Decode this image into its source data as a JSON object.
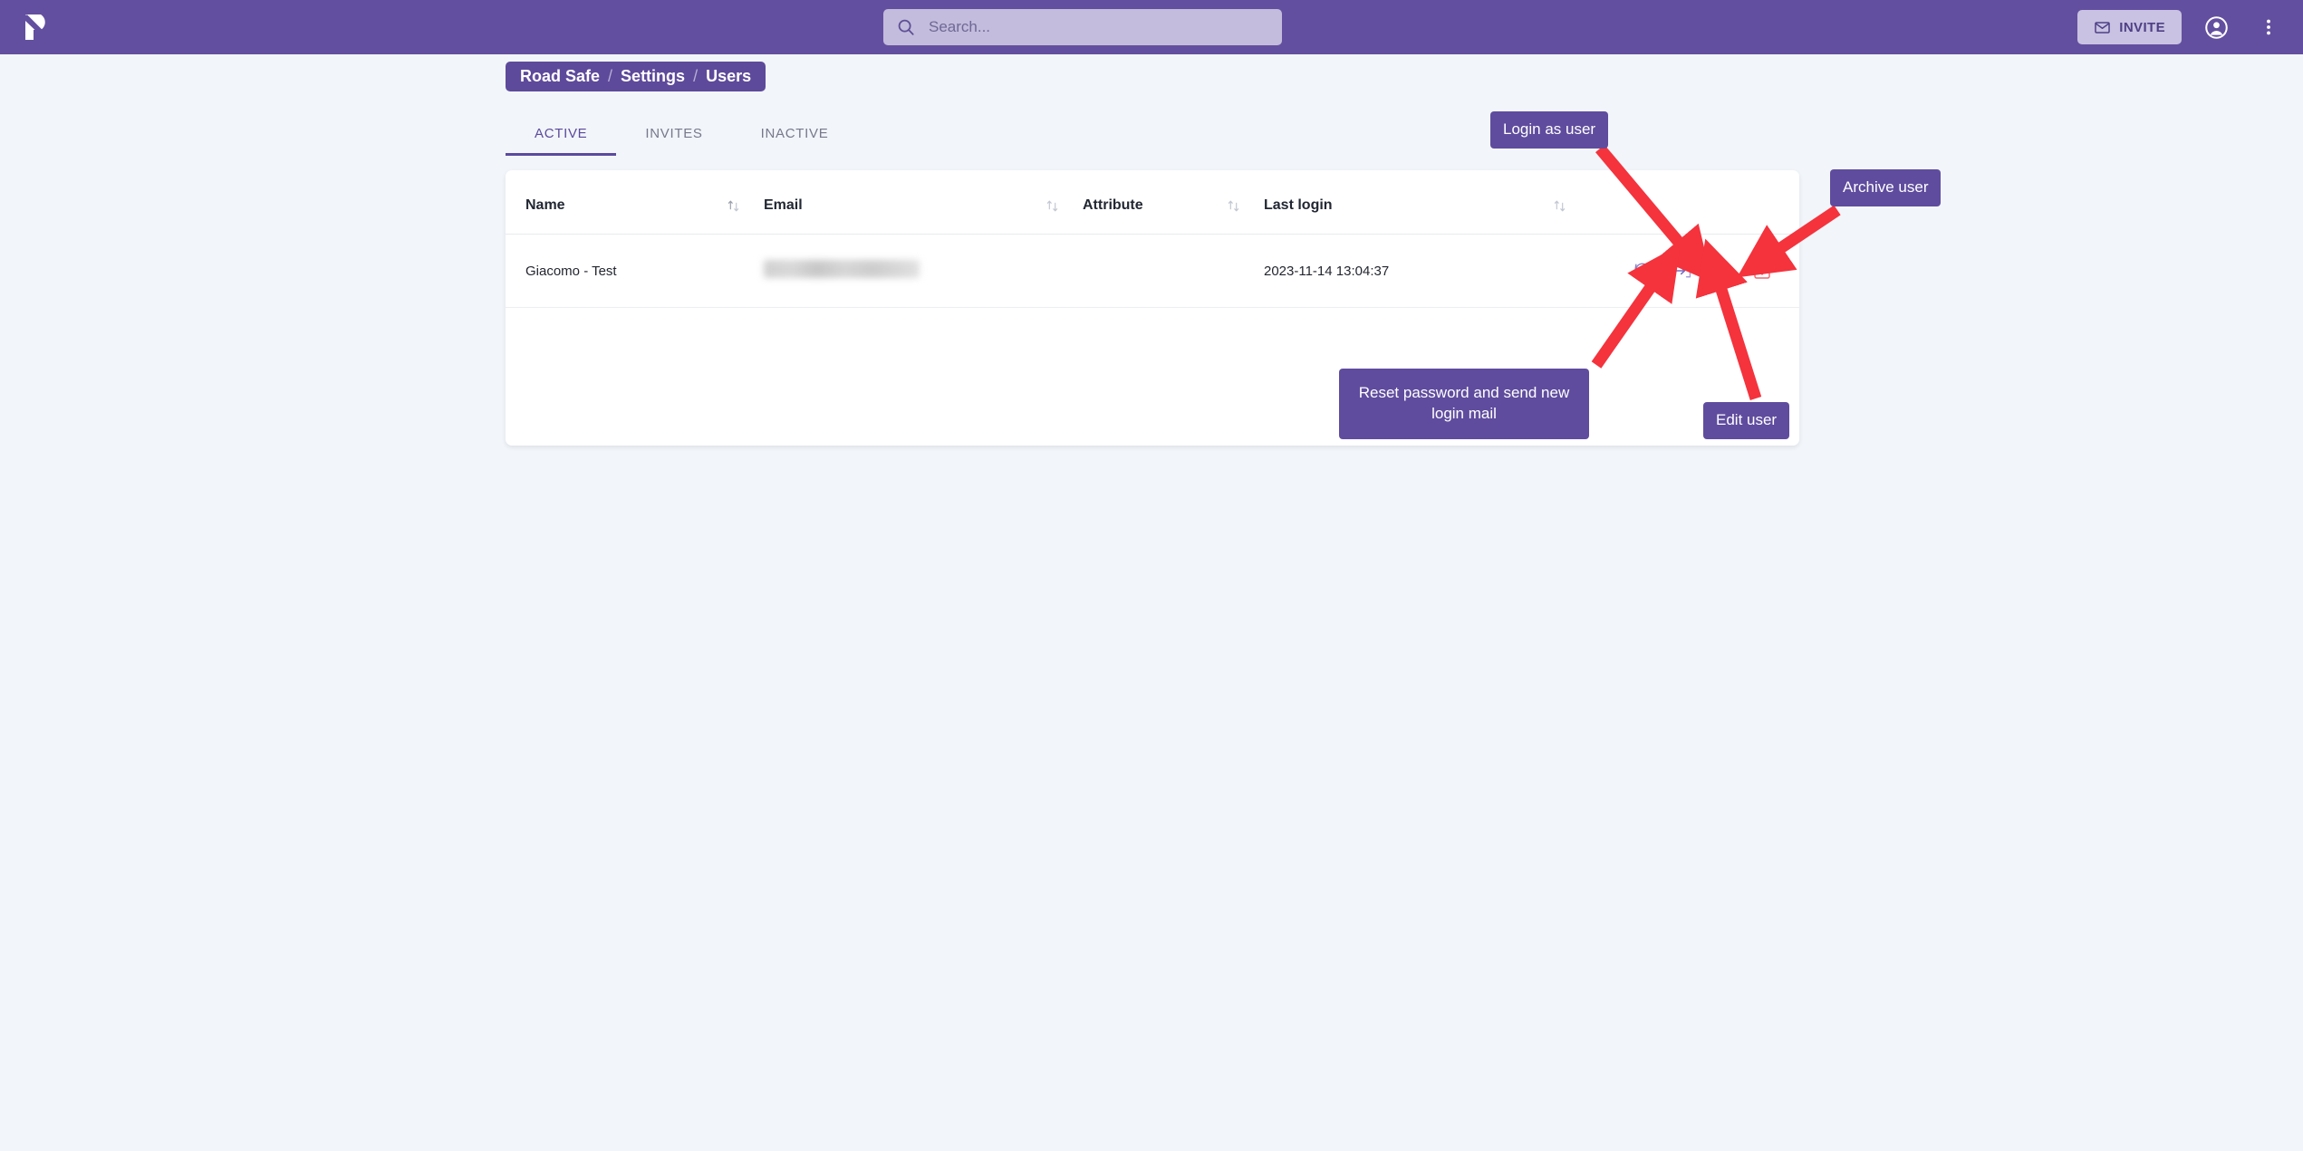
{
  "colors": {
    "brand_purple": "#634f9f",
    "brand_purple_dark": "#5e4a9b",
    "page_bg": "#f2f5f9",
    "card_bg": "#ffffff",
    "accent_red": "#f4333d",
    "archive_red": "#e8616b",
    "tab_active": "#5b4a9e"
  },
  "appbar": {
    "logo_name": "app-logo",
    "search": {
      "icon": "search-icon",
      "placeholder": "Search...",
      "value": ""
    },
    "invite_label": "INVITE",
    "invite_icon": "envelope-icon",
    "account_icon": "account-circle-icon",
    "more_icon": "more-vertical-icon"
  },
  "breadcrumb": {
    "items": [
      "Road Safe",
      "Settings",
      "Users"
    ],
    "separator": "/"
  },
  "tabs": [
    {
      "label": "ACTIVE",
      "active": true
    },
    {
      "label": "INVITES",
      "active": false
    },
    {
      "label": "INACTIVE",
      "active": false
    }
  ],
  "table": {
    "columns": [
      {
        "label": "Name",
        "sortable": true
      },
      {
        "label": "Email",
        "sortable": true
      },
      {
        "label": "Attribute",
        "sortable": true
      },
      {
        "label": "Last login",
        "sortable": true
      },
      {
        "label": "",
        "sortable": false
      }
    ],
    "rows": [
      {
        "name": "Giacomo - Test",
        "email": "",
        "email_redacted": true,
        "attribute": "",
        "last_login": "2023-11-14 13:04:37",
        "actions": [
          "reset-password-icon",
          "login-as-user-icon",
          "edit-user-icon",
          "archive-user-icon"
        ]
      }
    ]
  },
  "annotations": [
    {
      "id": "login",
      "text": "Login as user"
    },
    {
      "id": "archive",
      "text": "Archive user"
    },
    {
      "id": "reset",
      "text": "Reset password and send new login mail"
    },
    {
      "id": "edit",
      "text": "Edit user"
    }
  ]
}
